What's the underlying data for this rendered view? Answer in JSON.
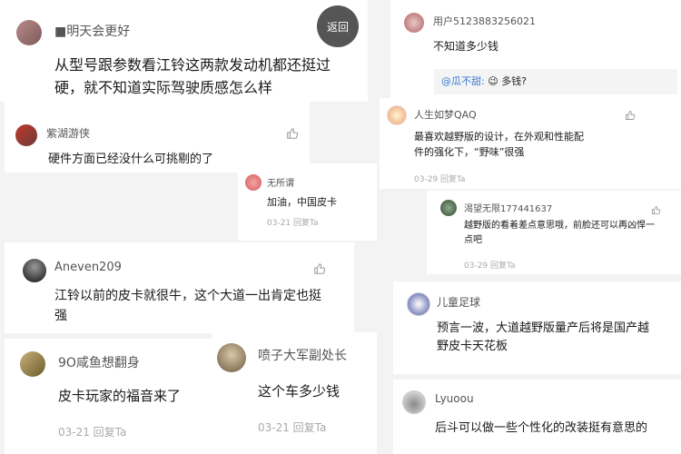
{
  "back_label": "返回",
  "posts": {
    "p1": {
      "user": "■明天会更好",
      "text": "从型号跟参数看江铃这两款发动机都还挺过硬，就不知道实际驾驶质感怎么样"
    },
    "p2": {
      "user": "紫湖游侠",
      "text": "硬件方面已经没什么可挑剔的了"
    },
    "p3": {
      "user": "无所谓",
      "text": "加油，中国皮卡",
      "meta": "03-21 回复Ta"
    },
    "p4": {
      "user": "Aneven209",
      "text": "江铃以前的皮卡就很牛，这个大道一出肯定也挺强"
    },
    "p5": {
      "user": "9O咸鱼想翻身",
      "text": "皮卡玩家的福音来了",
      "meta": "03-21 回复Ta"
    },
    "p6": {
      "user": "喷子大军副处长",
      "text": "这个车多少钱",
      "meta": "03-21 回复Ta"
    },
    "p7": {
      "user": "用户5123883256021",
      "text": "不知道多少钱",
      "reply_mention": "@瓜不甜:",
      "reply_emoji": "😉",
      "reply_text": "多钱?"
    },
    "p8": {
      "user": "人生如梦QAQ",
      "text": "最喜欢越野版的设计，在外观和性能配件的强化下，“野味”很强",
      "meta": "03-29 回复Ta"
    },
    "p9": {
      "user": "渴望无限177441637",
      "text": "越野版的看着差点意思哦，前脸还可以再凶悍一点吧",
      "meta": "03-29 回复Ta"
    },
    "p10": {
      "user": "儿童足球",
      "text": "预言一波，大道越野版量产后将是国产越野皮卡天花板"
    },
    "p11": {
      "user": "Lyuoou",
      "text": "后斗可以做一些个性化的改装挺有意思的"
    }
  },
  "colors": {
    "mention": "#3a7bd5",
    "meta": "#aaaaaa",
    "back_bg": "#555555"
  }
}
